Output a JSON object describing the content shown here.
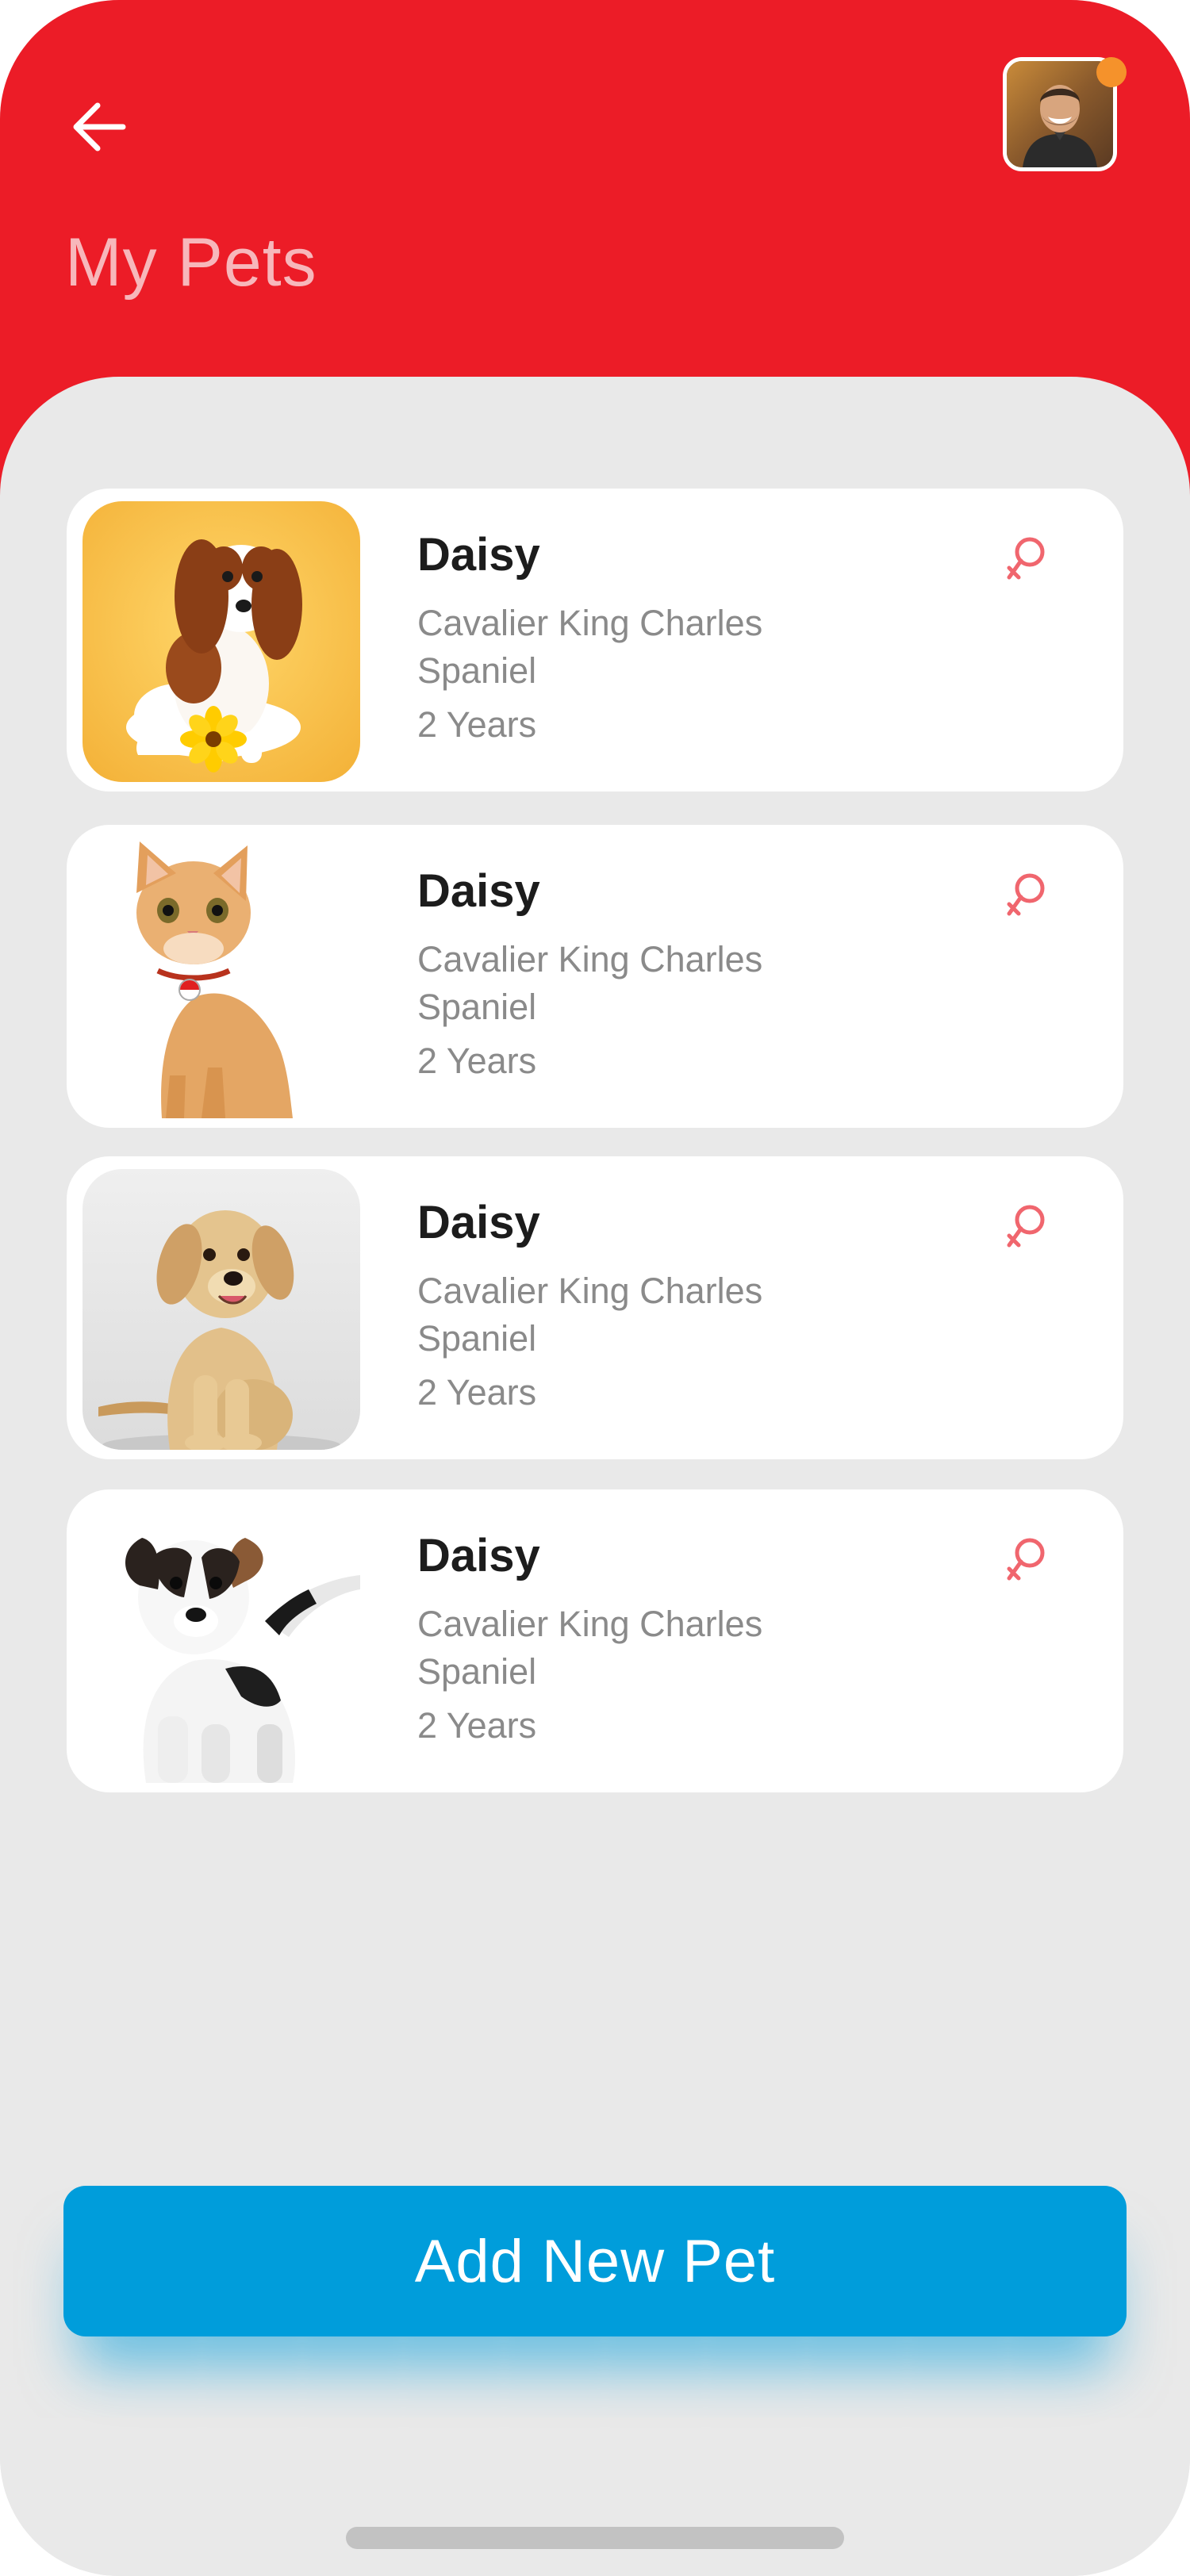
{
  "header": {
    "title": "My Pets",
    "back_icon": "arrow-left-icon",
    "avatar_icon": "user-avatar",
    "notification_color": "#f5922b",
    "background_color": "#ec1c27"
  },
  "pets": [
    {
      "name": "Daisy",
      "breed": "Cavalier King Charles Spaniel",
      "age": "2 Years",
      "photo": "cavalier-spaniel-photo",
      "gender_icon": "female-symbol-icon"
    },
    {
      "name": "Daisy",
      "breed": "Cavalier King Charles Spaniel",
      "age": "2 Years",
      "photo": "kitten-photo",
      "gender_icon": "female-symbol-icon"
    },
    {
      "name": "Daisy",
      "breed": "Cavalier King Charles Spaniel",
      "age": "2 Years",
      "photo": "golden-retriever-puppy-photo",
      "gender_icon": "female-symbol-icon"
    },
    {
      "name": "Daisy",
      "breed": "Cavalier King Charles Spaniel",
      "age": "2 Years",
      "photo": "jack-russell-puppy-photo",
      "gender_icon": "female-symbol-icon"
    }
  ],
  "add_button": {
    "label": "Add New Pet",
    "color": "#009ddb"
  }
}
